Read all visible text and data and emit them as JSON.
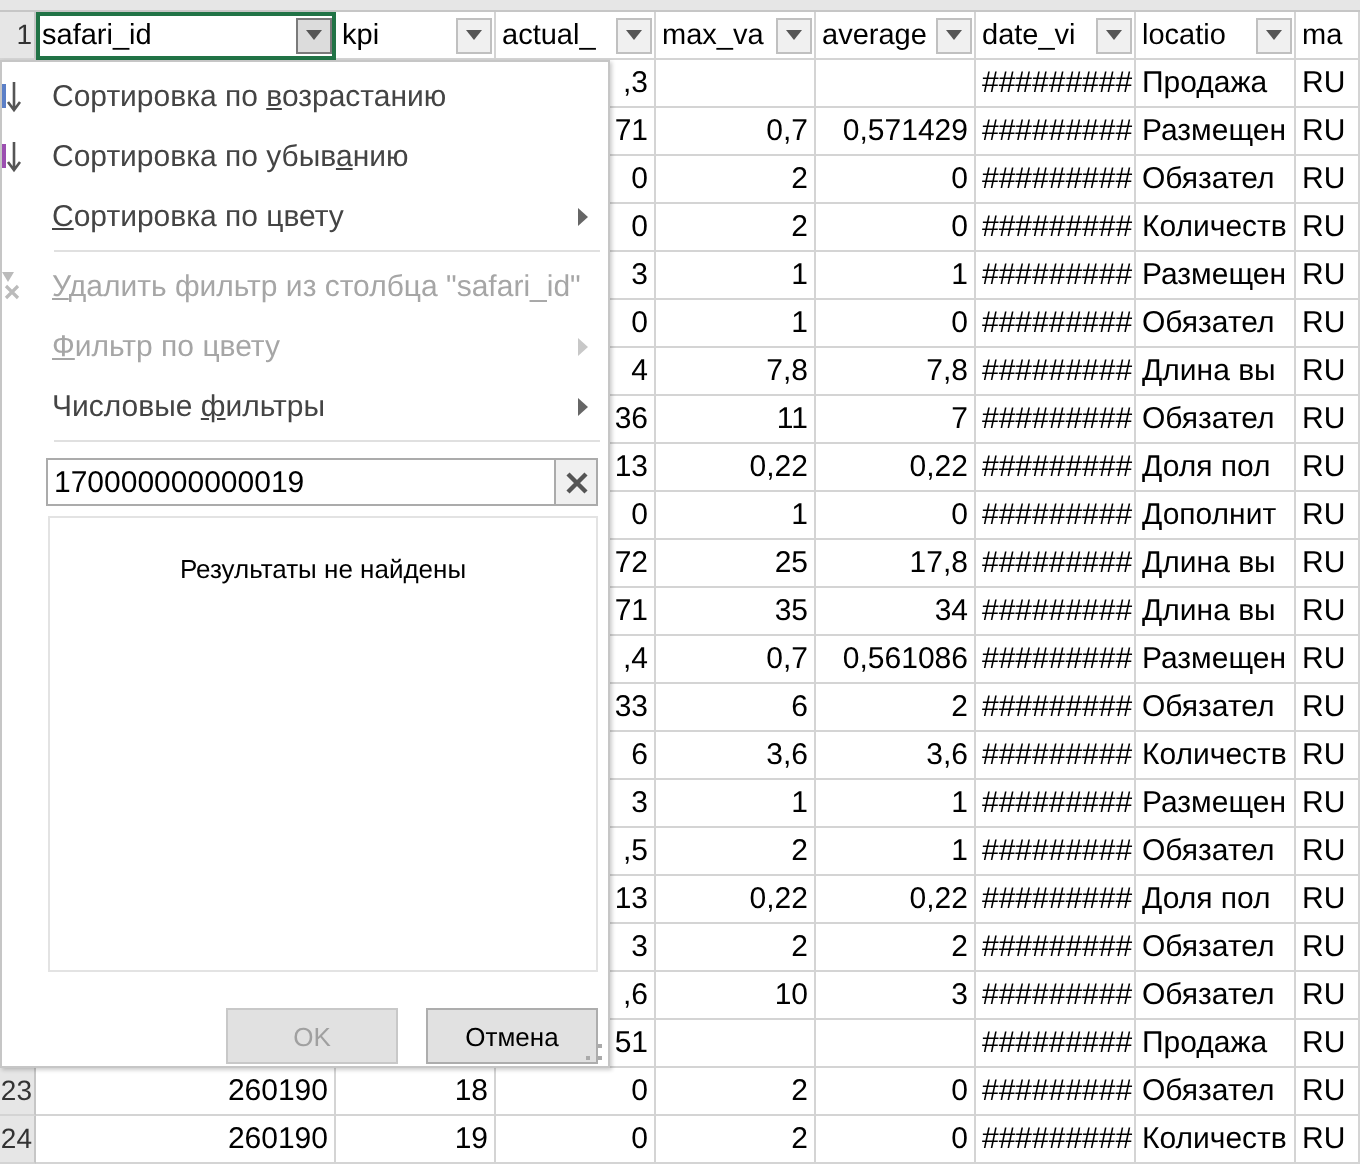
{
  "sheet": {
    "first_row_header": "1",
    "headers": [
      {
        "label": "safari_id",
        "filter_open": true
      },
      {
        "label": "kpi",
        "filter_open": false
      },
      {
        "label": "actual_",
        "filter_open": false
      },
      {
        "label": "max_va",
        "filter_open": false
      },
      {
        "label": "average",
        "filter_open": false
      },
      {
        "label": "date_vi",
        "filter_open": false
      },
      {
        "label": "locatio",
        "filter_open": false
      },
      {
        "label": "ma"
      }
    ],
    "rows": [
      {
        "cells": {
          "c": ",3",
          "f": "#########",
          "g": "Продажа",
          "h": "RU"
        }
      },
      {
        "cells": {
          "c": "71",
          "d": "0,7",
          "e": "0,571429",
          "f": "#########",
          "g": "Размещен",
          "h": "RU"
        }
      },
      {
        "cells": {
          "c": "0",
          "d": "2",
          "e": "0",
          "f": "#########",
          "g": "Обязател",
          "h": "RU"
        }
      },
      {
        "cells": {
          "c": "0",
          "d": "2",
          "e": "0",
          "f": "#########",
          "g": "Количеств",
          "h": "RU"
        }
      },
      {
        "cells": {
          "c": "3",
          "d": "1",
          "e": "1",
          "f": "#########",
          "g": "Размещен",
          "h": "RU"
        }
      },
      {
        "cells": {
          "c": "0",
          "d": "1",
          "e": "0",
          "f": "#########",
          "g": "Обязател",
          "h": "RU"
        }
      },
      {
        "cells": {
          "c": "4",
          "d": "7,8",
          "e": "7,8",
          "f": "#########",
          "g": "Длина вы",
          "h": "RU"
        }
      },
      {
        "cells": {
          "c": "36",
          "d": "11",
          "e": "7",
          "f": "#########",
          "g": "Обязател",
          "h": "RU"
        }
      },
      {
        "cells": {
          "c": "13",
          "d": "0,22",
          "e": "0,22",
          "f": "#########",
          "g": "Доля пол",
          "h": "RU"
        }
      },
      {
        "cells": {
          "c": "0",
          "d": "1",
          "e": "0",
          "f": "#########",
          "g": "Дополнит",
          "h": "RU"
        }
      },
      {
        "cells": {
          "c": "72",
          "d": "25",
          "e": "17,8",
          "f": "#########",
          "g": "Длина вы",
          "h": "RU"
        }
      },
      {
        "cells": {
          "c": "71",
          "d": "35",
          "e": "34",
          "f": "#########",
          "g": "Длина вы",
          "h": "RU"
        }
      },
      {
        "cells": {
          "c": ",4",
          "d": "0,7",
          "e": "0,561086",
          "f": "#########",
          "g": "Размещен",
          "h": "RU"
        }
      },
      {
        "cells": {
          "c": "33",
          "d": "6",
          "e": "2",
          "f": "#########",
          "g": "Обязател",
          "h": "RU"
        }
      },
      {
        "cells": {
          "c": "6",
          "d": "3,6",
          "e": "3,6",
          "f": "#########",
          "g": "Количеств",
          "h": "RU"
        }
      },
      {
        "cells": {
          "c": "3",
          "d": "1",
          "e": "1",
          "f": "#########",
          "g": "Размещен",
          "h": "RU"
        }
      },
      {
        "cells": {
          "c": ",5",
          "d": "2",
          "e": "1",
          "f": "#########",
          "g": "Обязател",
          "h": "RU"
        }
      },
      {
        "cells": {
          "c": "13",
          "d": "0,22",
          "e": "0,22",
          "f": "#########",
          "g": "Доля пол",
          "h": "RU"
        }
      },
      {
        "cells": {
          "c": "3",
          "d": "2",
          "e": "2",
          "f": "#########",
          "g": "Обязател",
          "h": "RU"
        }
      },
      {
        "cells": {
          "c": ",6",
          "d": "10",
          "e": "3",
          "f": "#########",
          "g": "Обязател",
          "h": "RU"
        }
      },
      {
        "cells": {
          "c": "51",
          "f": "#########",
          "g": "Продажа",
          "h": "RU"
        }
      },
      {
        "row_header": "23",
        "cells": {
          "a": "260190",
          "b": "18",
          "c": "0",
          "d": "2",
          "e": "0",
          "f": "#########",
          "g": "Обязател",
          "h": "RU"
        }
      },
      {
        "row_header": "24",
        "cells": {
          "a": "260190",
          "b": "19",
          "c": "0",
          "d": "2",
          "e": "0",
          "f": "#########",
          "g": "Количеств",
          "h": "RU"
        }
      }
    ]
  },
  "filter_menu": {
    "items": [
      {
        "kind": "sort_asc",
        "label": {
          "before": "Сортировка по ",
          "key": "в",
          "after": "озрастанию"
        },
        "disabled": false
      },
      {
        "kind": "sort_desc",
        "label": {
          "before": "Сортировка по убыв",
          "key": "а",
          "after": "нию"
        },
        "disabled": false
      },
      {
        "kind": "submenu",
        "label": {
          "key": "С",
          "after": "ортировка по цвету"
        },
        "disabled": false
      },
      {
        "kind": "separator"
      },
      {
        "kind": "clear",
        "label": {
          "key": "У",
          "after": "далить фильтр из столбца \"safari_id\""
        },
        "disabled": true
      },
      {
        "kind": "submenu",
        "label": {
          "key": "Ф",
          "after": "ильтр по цвету"
        },
        "disabled": true
      },
      {
        "kind": "submenu",
        "label": {
          "before": "Числовые ",
          "key": "ф",
          "after": "ильтры"
        },
        "disabled": false
      },
      {
        "kind": "separator"
      }
    ],
    "search_value": "170000000000019",
    "message": "Результаты не найдены",
    "buttons": [
      {
        "label": "OK",
        "disabled": true
      },
      {
        "label": "Отмена",
        "disabled": false
      }
    ]
  }
}
